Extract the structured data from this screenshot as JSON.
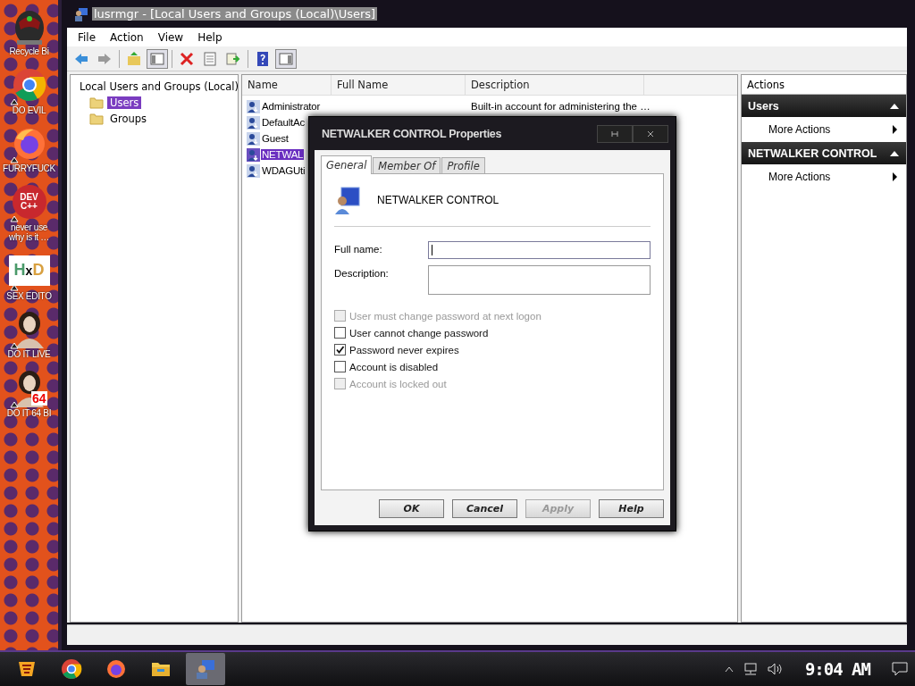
{
  "desktop": {
    "icons": [
      {
        "kind": "helmet",
        "label": "Recycle Bi",
        "shortcut": false
      },
      {
        "kind": "chrome",
        "label": "DO EVIL",
        "shortcut": true
      },
      {
        "kind": "firefox",
        "label": "FURRYFUCK",
        "shortcut": true
      },
      {
        "kind": "devcpp",
        "label": "never use\nwhy is it …",
        "logo": [
          "DEV",
          "C++"
        ],
        "shortcut": true
      },
      {
        "kind": "hxd",
        "label": "SEX EDITO",
        "logo": [
          "H",
          "x",
          "D"
        ],
        "shortcut": true
      },
      {
        "kind": "portrait",
        "label": "DO IT LIVE",
        "shortcut": true
      },
      {
        "kind": "portrait",
        "label": "DO IT 64 BI",
        "logo": [
          "64"
        ],
        "shortcut": true
      }
    ]
  },
  "window": {
    "title": "lusrmgr - [Local Users and Groups (Local)\\Users]",
    "menu": [
      "File",
      "Action",
      "View",
      "Help"
    ],
    "toolbar": [
      {
        "kind": "back",
        "pressed": false
      },
      {
        "kind": "forward",
        "pressed": false
      },
      {
        "kind": "sep"
      },
      {
        "kind": "up",
        "pressed": false
      },
      {
        "kind": "tree",
        "pressed": true
      },
      {
        "kind": "sep"
      },
      {
        "kind": "delete",
        "pressed": false
      },
      {
        "kind": "properties",
        "pressed": false
      },
      {
        "kind": "export",
        "pressed": false
      },
      {
        "kind": "sep"
      },
      {
        "kind": "help",
        "pressed": false
      },
      {
        "kind": "pane",
        "pressed": true
      }
    ]
  },
  "tree": {
    "label": "Local Users and Groups (Local)",
    "children": [
      {
        "label": "Users",
        "selected": true
      },
      {
        "label": "Groups",
        "selected": false
      }
    ]
  },
  "table": {
    "columns": [
      "Name",
      "Full Name",
      "Description"
    ],
    "rows": [
      {
        "name": "Administrator",
        "description": "Built-in account for administering the …",
        "selected": false
      },
      {
        "name": "DefaultAc",
        "selected": false
      },
      {
        "name": "Guest",
        "selected": false
      },
      {
        "name": "NETWAL",
        "selected": true
      },
      {
        "name": "WDAGUti",
        "selected": false
      }
    ]
  },
  "actions": {
    "title": "Actions",
    "sections": [
      {
        "title": "Users",
        "items": [
          "More Actions"
        ]
      },
      {
        "title": "NETWALKER CONTROL",
        "items": [
          "More Actions"
        ]
      }
    ]
  },
  "dialog": {
    "title": "NETWALKER CONTROL Properties",
    "tabs": [
      {
        "label": "General",
        "selected": true
      },
      {
        "label": "Member Of",
        "selected": false
      },
      {
        "label": "Profile",
        "selected": false
      }
    ],
    "user": "NETWALKER CONTROL",
    "fields": [
      {
        "label": "Full name:",
        "kind": "line",
        "focused": true
      },
      {
        "label": "Description:",
        "kind": "box",
        "focused": false
      }
    ],
    "checkboxes": [
      {
        "label": "User must change password at next logon",
        "checked": false,
        "disabled": true
      },
      {
        "label": "User cannot change password",
        "checked": false,
        "disabled": false
      },
      {
        "label": "Password never expires",
        "checked": true,
        "disabled": false
      },
      {
        "label": "Account is disabled",
        "checked": false,
        "disabled": false
      },
      {
        "label": "Account is locked out",
        "checked": false,
        "disabled": true
      }
    ],
    "buttons": [
      {
        "label": "OK",
        "disabled": false
      },
      {
        "label": "Cancel",
        "disabled": false
      },
      {
        "label": "Apply",
        "disabled": true
      },
      {
        "label": "Help",
        "disabled": false
      }
    ]
  },
  "taskbar": {
    "apps": [
      {
        "kind": "start",
        "active": false
      },
      {
        "kind": "chrome",
        "active": false
      },
      {
        "kind": "firefox",
        "active": false
      },
      {
        "kind": "folder",
        "active": false
      },
      {
        "kind": "users",
        "active": true
      }
    ],
    "clock": "9:04 AM"
  }
}
